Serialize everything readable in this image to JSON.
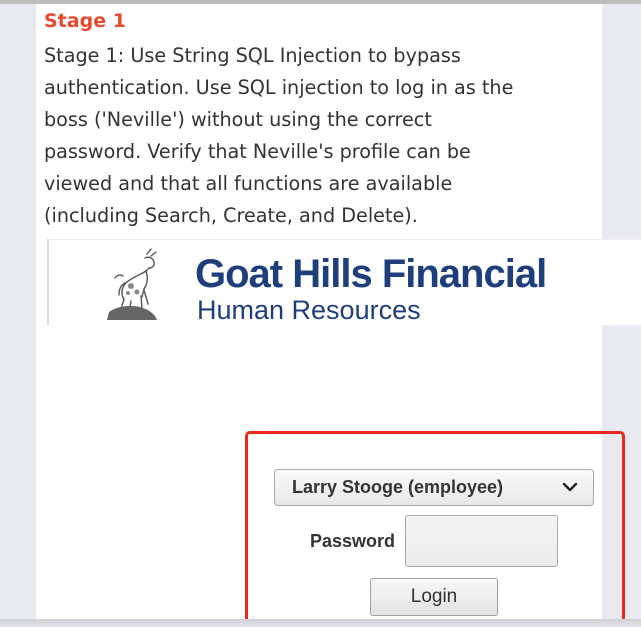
{
  "lesson": {
    "stage_title": "Stage 1",
    "stage_text_lines": [
      "Stage 1: Use String SQL Injection to bypass",
      "authentication. Use SQL injection to log in as the",
      "boss ('Neville') without using the correct",
      "password. Verify that Neville's profile can be",
      "viewed and that all functions are available",
      "(including Search, Create, and Delete)."
    ]
  },
  "banner": {
    "title": "Goat Hills Financial",
    "subtitle": "Human Resources",
    "logo_icon": "goat-logo-icon"
  },
  "login_form": {
    "employee_selected": "Larry Stooge (employee)",
    "password_label": "Password",
    "password_value": "",
    "login_label": "Login"
  },
  "colors": {
    "stage_title": "#e8482c",
    "brand": "#1e3e7c",
    "highlight_border": "#e8291c"
  }
}
